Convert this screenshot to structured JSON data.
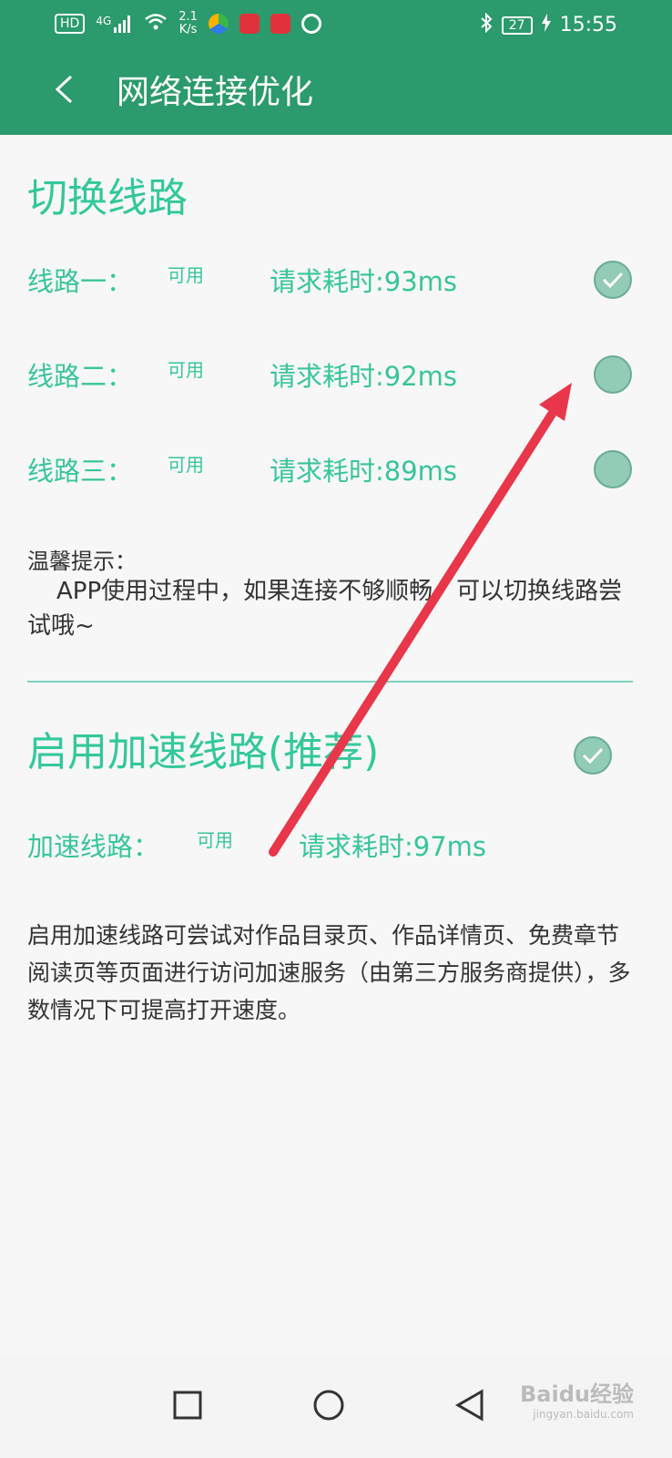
{
  "status_bar": {
    "hd": "HD",
    "network": "4G",
    "speed_value": "2.1",
    "speed_unit": "K/s",
    "battery": "27",
    "time": "15:55"
  },
  "header": {
    "title": "网络连接优化"
  },
  "switch_section": {
    "title": "切换线路",
    "routes": [
      {
        "name": "线路一：",
        "status": "可用",
        "latency": "请求耗时:93ms",
        "selected": true
      },
      {
        "name": "线路二：",
        "status": "可用",
        "latency": "请求耗时:92ms",
        "selected": false
      },
      {
        "name": "线路三：",
        "status": "可用",
        "latency": "请求耗时:89ms",
        "selected": false
      }
    ],
    "hint_title": "温馨提示：",
    "hint_body": "APP使用过程中，如果连接不够顺畅，可以切换线路尝试哦~"
  },
  "accel_section": {
    "title": "启用加速线路(推荐)",
    "enabled": true,
    "route_name": "加速线路：",
    "route_status": "可用",
    "route_latency": "请求耗时:97ms",
    "description": "启用加速线路可尝试对作品目录页、作品详情页、免费章节阅读页等页面进行访问加速服务（由第三方服务商提供），多数情况下可提高打开速度。"
  },
  "watermark": {
    "brand": "Baidu经验",
    "url": "jingyan.baidu.com"
  },
  "colors": {
    "header": "#2b9a6c",
    "accent_text": "#33c89a",
    "radio_fill": "#92cbb6"
  }
}
